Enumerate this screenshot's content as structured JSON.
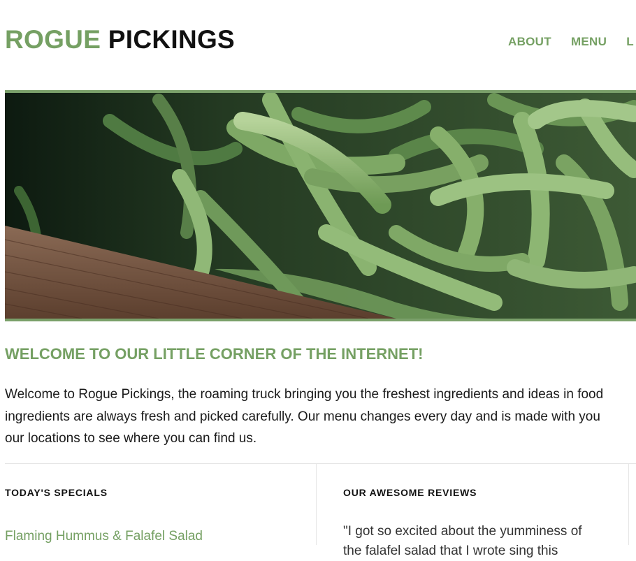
{
  "header": {
    "logo_accent": "ROGUE",
    "logo_dark": "PICKINGS",
    "nav": [
      "ABOUT",
      "MENU",
      "L"
    ]
  },
  "hero": {
    "image_subject": "green-beans-on-wooden-crate",
    "border_color": "#7aa06a"
  },
  "welcome": {
    "heading": "WELCOME TO OUR LITTLE CORNER OF THE INTERNET!",
    "lines": [
      "Welcome to Rogue Pickings, the roaming truck bringing you the freshest ingredients and ideas in food",
      "ingredients are always fresh and picked carefully. Our menu changes every day and is made with you",
      "our locations to see where you can find us."
    ]
  },
  "specials": {
    "heading": "TODAY'S SPECIALS",
    "items": [
      "Flaming Hummus & Falafel Salad"
    ]
  },
  "reviews": {
    "heading": "OUR AWESOME REVIEWS",
    "lines": [
      "\"I got so excited about the yumminess of",
      "the falafel salad that I wrote sing this"
    ]
  },
  "colors": {
    "accent": "#75a063",
    "text": "#1a1a1a",
    "divider": "#e6e6e6"
  }
}
